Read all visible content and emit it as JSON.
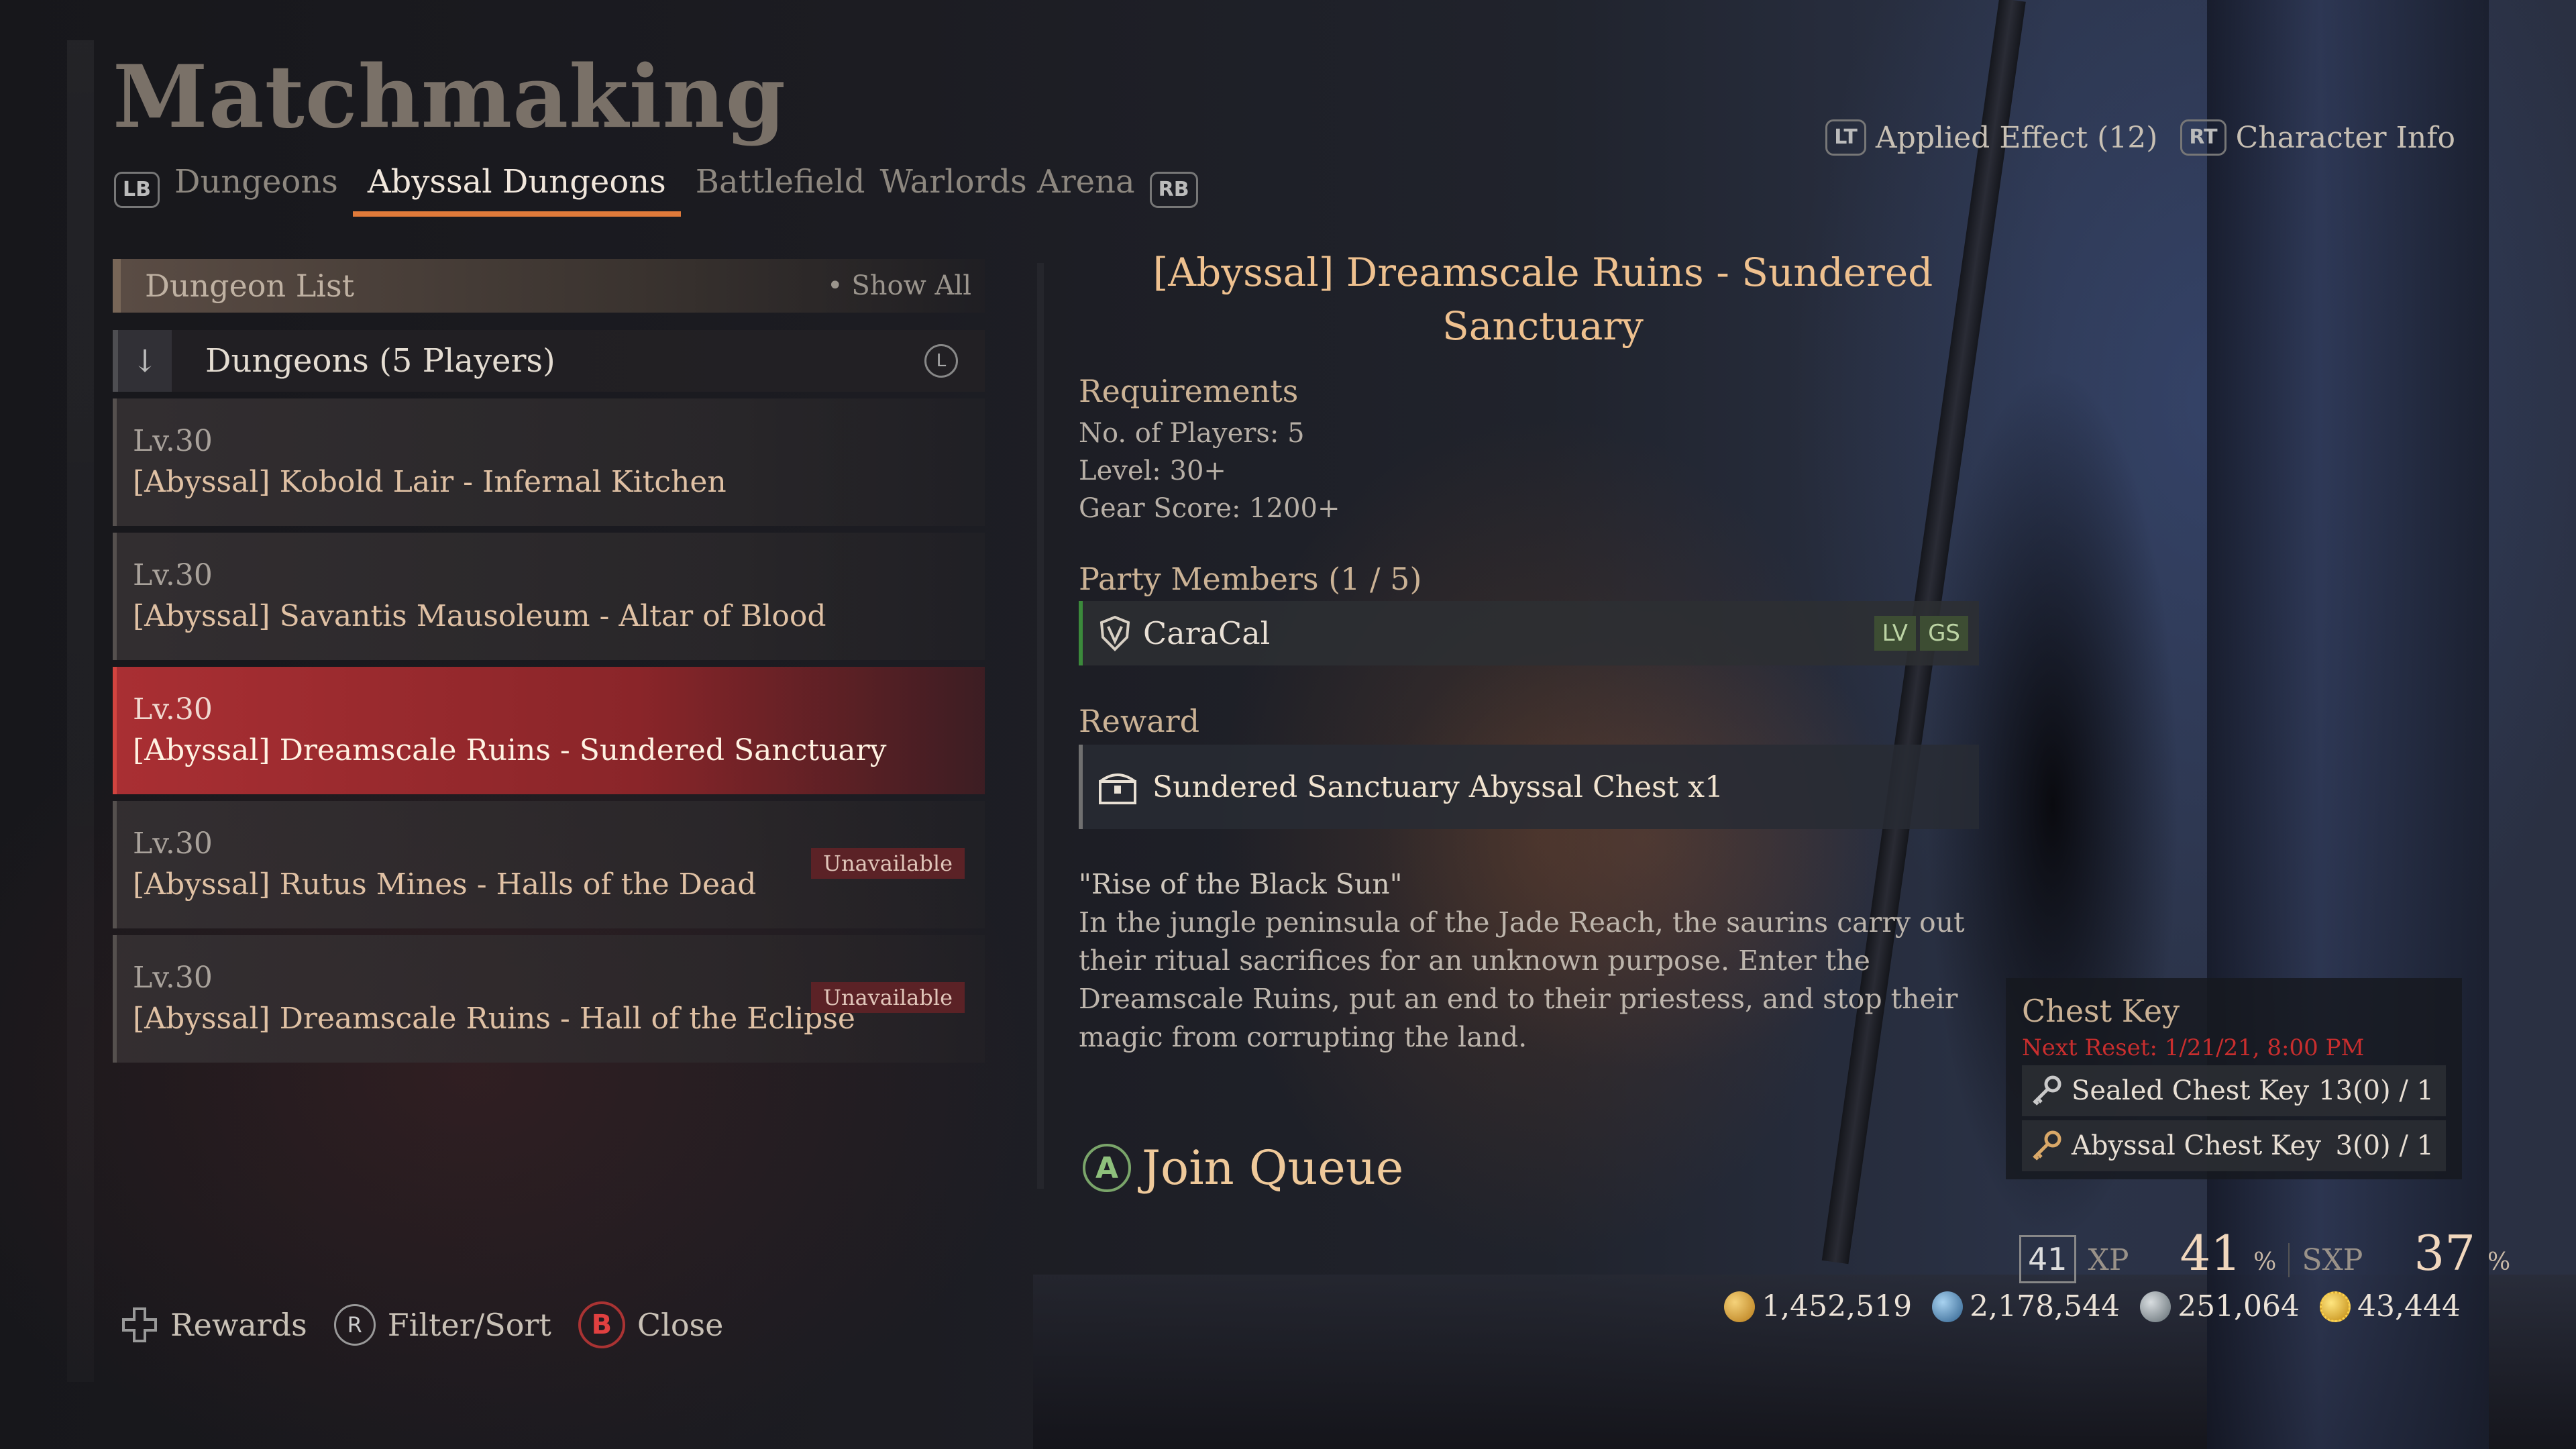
{
  "page_title": "Matchmaking",
  "tabs": {
    "lb_badge": "LB",
    "rb_badge": "RB",
    "items": [
      {
        "label": "Dungeons"
      },
      {
        "label": "Abyssal Dungeons",
        "active": true
      },
      {
        "label": "Battlefield"
      },
      {
        "label": "Warlords Arena"
      }
    ]
  },
  "top_right": {
    "lt_badge": "LT",
    "applied_effect": "Applied Effect (12)",
    "rt_badge": "RT",
    "character_info": "Character Info"
  },
  "dungeon_list": {
    "title": "Dungeon List",
    "show_all": "Show All",
    "group_label": "Dungeons (5 Players)",
    "stick_label": "L",
    "items": [
      {
        "level": "Lv.30",
        "name": "[Abyssal] Kobold Lair - Infernal Kitchen",
        "status": ""
      },
      {
        "level": "Lv.30",
        "name": "[Abyssal] Savantis Mausoleum - Altar of Blood",
        "status": ""
      },
      {
        "level": "Lv.30",
        "name": "[Abyssal] Dreamscale Ruins - Sundered Sanctuary",
        "status": "",
        "selected": true
      },
      {
        "level": "Lv.30",
        "name": "[Abyssal] Rutus Mines - Halls of the Dead",
        "status": "Unavailable"
      },
      {
        "level": "Lv.30",
        "name": "[Abyssal] Dreamscale Ruins - Hall of the Eclipse",
        "status": "Unavailable"
      }
    ]
  },
  "details": {
    "title": "[Abyssal] Dreamscale Ruins - Sundered Sanctuary",
    "requirements_label": "Requirements",
    "requirements": [
      "No. of Players: 5",
      "Level: 30+",
      "Gear Score: 1200+"
    ],
    "party_label": "Party Members (1 / 5)",
    "member_name": "CaraCal",
    "member_lv": "LV",
    "member_gs": "GS",
    "reward_label": "Reward",
    "reward_name": "Sundered Sanctuary Abyssal Chest x1",
    "desc_title": "\"Rise of the Black Sun\"",
    "desc_body": "In the jungle peninsula of the Jade Reach, the saurins carry out their ritual sacrifices for an unknown purpose. Enter the Dreamscale Ruins, put an end to their priestess, and stop their magic from corrupting the land.",
    "join_button_glyph": "A",
    "join_label": "Join Queue"
  },
  "chest_key": {
    "title": "Chest Key",
    "reset": "Next Reset: 1/21/21, 8:00 PM",
    "keys": [
      {
        "name": "Sealed Chest Key",
        "count": "13(0) / 1"
      },
      {
        "name": "Abyssal Chest Key",
        "count": "3(0) / 1"
      }
    ]
  },
  "progress": {
    "level": "41",
    "xp_label": "XP",
    "xp_value": "41",
    "xp_unit": "%",
    "sxp_label": "SXP",
    "sxp_value": "37",
    "sxp_unit": "%"
  },
  "currency": [
    {
      "icon": "gold-coin-icon",
      "value": "1,452,519",
      "color": "#d9a232"
    },
    {
      "icon": "blue-token-icon",
      "value": "2,178,544",
      "color": "#4f8fc4"
    },
    {
      "icon": "silver-ore-icon",
      "value": "251,064",
      "color": "#9aa3a7"
    },
    {
      "icon": "gear-token-icon",
      "value": "43,444",
      "color": "#e1b934"
    }
  ],
  "bottom_bar": {
    "rewards": "Rewards",
    "filter_glyph": "R",
    "filter": "Filter/Sort",
    "close_glyph": "B",
    "close": "Close"
  },
  "colors": {
    "accent": "#e07a3a",
    "selected_row": "#a92f33",
    "title_gold": "#efc18f",
    "reset_red": "#c92e2e"
  }
}
